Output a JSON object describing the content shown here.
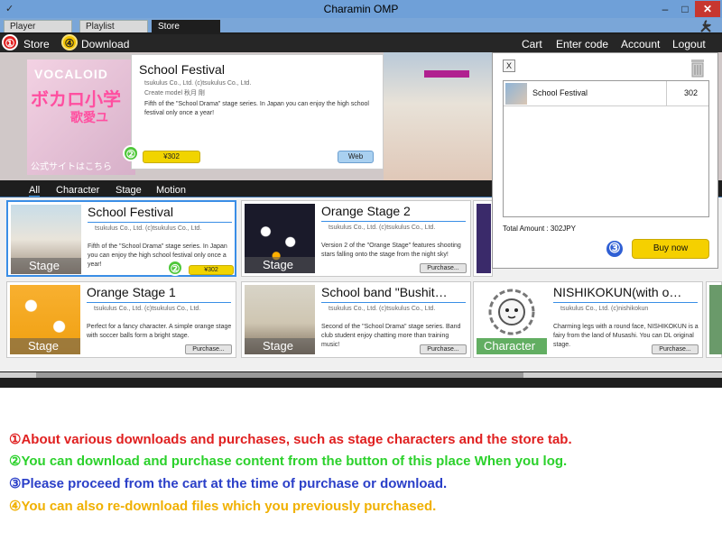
{
  "window": {
    "title": "Charamin OMP",
    "minimize": "–",
    "maximize": "□",
    "close": "✕"
  },
  "tabs": [
    {
      "label": "Player"
    },
    {
      "label": "Playlist"
    },
    {
      "label": "Store"
    }
  ],
  "menu": {
    "store": "Store",
    "download": "Download",
    "cart": "Cart",
    "enter_code": "Enter code",
    "account": "Account",
    "logout": "Logout"
  },
  "markers": {
    "one": "①",
    "two": "②",
    "three": "③",
    "four": "④"
  },
  "hero": {
    "brand": "VOCALOID",
    "jp_title": "ボカロ小学",
    "jp_sub": "歌愛ユ",
    "jp_link": "公式サイトはこちら",
    "popup": {
      "title": "School Festival",
      "publisher": "tsukulus Co., Ltd.  (c)tsukulus Co., Ltd.",
      "model": "Create model 秋月 剛",
      "desc": "Fifth of the \"School Drama\" stage series.  In Japan you can enjoy the high school festival only once a year!",
      "price": "¥302",
      "web": "Web"
    }
  },
  "categories": [
    "All",
    "Character",
    "Stage",
    "Motion"
  ],
  "products": [
    {
      "title": "School Festival",
      "meta": "tsukulus Co., Ltd.  (c)tsukulus Co., Ltd.",
      "desc": "Fifth of the \"School Drama\" stage series.  In Japan you can enjoy the high school festival only once a year!",
      "type": "Stage",
      "action": "¥302"
    },
    {
      "title": "Orange Stage 2",
      "meta": "tsukulus Co., Ltd.  (c)tsukulus Co., Ltd.",
      "desc": "Version 2 of the \"Orange Stage\" features shooting stars falling onto the stage from the night sky!",
      "type": "Stage",
      "action": "Purchase..."
    },
    {
      "title": "Orange Stage 1",
      "meta": "tsukulus Co., Ltd.  (c)tsukulus Co., Ltd.",
      "desc": "Perfect for a fancy character.  A simple orange stage with soccer balls form a bright stage.",
      "type": "Stage",
      "action": "Purchase..."
    },
    {
      "title": "School  band \"Bushit…",
      "meta": "tsukulus Co., Ltd.  (c)tsukulus Co., Ltd.",
      "desc": "Second of the \"School Drama\" stage series.  Band club student enjoy chatting more than training music!",
      "type": "Stage",
      "action": "Purchase..."
    },
    {
      "title": "NISHIKOKUN(with o…",
      "meta": "tsukulus Co., Ltd.  (c)nishikokun",
      "desc": "Charming legs with a round face, NISHIKOKUN is a fairy from the land of Musashi.  You can DL original stage.",
      "type": "Character",
      "action": "Purchase..."
    }
  ],
  "cart": {
    "close": "X",
    "items": [
      {
        "name": "School Festival",
        "price": "302"
      }
    ],
    "total": "Total Amount : 302JPY",
    "buy_now": "Buy now"
  },
  "notes": [
    {
      "marker": "①",
      "text": "About various downloads and purchases, such as stage characters and the store tab."
    },
    {
      "marker": "②",
      "text": "You can download and purchase content from the button of this place When you log."
    },
    {
      "marker": "③",
      "text": "Please proceed from the cart at the time of purchase or download."
    },
    {
      "marker": "④",
      "text": "You can also re-download files which you previously purchased."
    }
  ],
  "colors": {
    "accent_blue": "#3a8ee6",
    "buy_yellow": "#f5d000",
    "note_red": "#e02020",
    "note_green": "#2bd12b",
    "note_blue": "#2a3fc8",
    "note_yellow": "#f0b000"
  },
  "icons": {
    "settings": "wrench-icon",
    "trash": "trash-icon"
  }
}
